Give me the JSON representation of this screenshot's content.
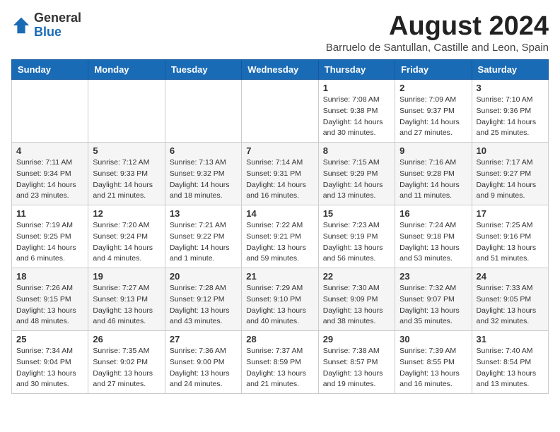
{
  "logo": {
    "general": "General",
    "blue": "Blue"
  },
  "title": "August 2024",
  "subtitle": "Barruelo de Santullan, Castille and Leon, Spain",
  "days_of_week": [
    "Sunday",
    "Monday",
    "Tuesday",
    "Wednesday",
    "Thursday",
    "Friday",
    "Saturday"
  ],
  "weeks": [
    [
      {
        "day": "",
        "info": ""
      },
      {
        "day": "",
        "info": ""
      },
      {
        "day": "",
        "info": ""
      },
      {
        "day": "",
        "info": ""
      },
      {
        "day": "1",
        "info": "Sunrise: 7:08 AM\nSunset: 9:38 PM\nDaylight: 14 hours\nand 30 minutes."
      },
      {
        "day": "2",
        "info": "Sunrise: 7:09 AM\nSunset: 9:37 PM\nDaylight: 14 hours\nand 27 minutes."
      },
      {
        "day": "3",
        "info": "Sunrise: 7:10 AM\nSunset: 9:36 PM\nDaylight: 14 hours\nand 25 minutes."
      }
    ],
    [
      {
        "day": "4",
        "info": "Sunrise: 7:11 AM\nSunset: 9:34 PM\nDaylight: 14 hours\nand 23 minutes."
      },
      {
        "day": "5",
        "info": "Sunrise: 7:12 AM\nSunset: 9:33 PM\nDaylight: 14 hours\nand 21 minutes."
      },
      {
        "day": "6",
        "info": "Sunrise: 7:13 AM\nSunset: 9:32 PM\nDaylight: 14 hours\nand 18 minutes."
      },
      {
        "day": "7",
        "info": "Sunrise: 7:14 AM\nSunset: 9:31 PM\nDaylight: 14 hours\nand 16 minutes."
      },
      {
        "day": "8",
        "info": "Sunrise: 7:15 AM\nSunset: 9:29 PM\nDaylight: 14 hours\nand 13 minutes."
      },
      {
        "day": "9",
        "info": "Sunrise: 7:16 AM\nSunset: 9:28 PM\nDaylight: 14 hours\nand 11 minutes."
      },
      {
        "day": "10",
        "info": "Sunrise: 7:17 AM\nSunset: 9:27 PM\nDaylight: 14 hours\nand 9 minutes."
      }
    ],
    [
      {
        "day": "11",
        "info": "Sunrise: 7:19 AM\nSunset: 9:25 PM\nDaylight: 14 hours\nand 6 minutes."
      },
      {
        "day": "12",
        "info": "Sunrise: 7:20 AM\nSunset: 9:24 PM\nDaylight: 14 hours\nand 4 minutes."
      },
      {
        "day": "13",
        "info": "Sunrise: 7:21 AM\nSunset: 9:22 PM\nDaylight: 14 hours\nand 1 minute."
      },
      {
        "day": "14",
        "info": "Sunrise: 7:22 AM\nSunset: 9:21 PM\nDaylight: 13 hours\nand 59 minutes."
      },
      {
        "day": "15",
        "info": "Sunrise: 7:23 AM\nSunset: 9:19 PM\nDaylight: 13 hours\nand 56 minutes."
      },
      {
        "day": "16",
        "info": "Sunrise: 7:24 AM\nSunset: 9:18 PM\nDaylight: 13 hours\nand 53 minutes."
      },
      {
        "day": "17",
        "info": "Sunrise: 7:25 AM\nSunset: 9:16 PM\nDaylight: 13 hours\nand 51 minutes."
      }
    ],
    [
      {
        "day": "18",
        "info": "Sunrise: 7:26 AM\nSunset: 9:15 PM\nDaylight: 13 hours\nand 48 minutes."
      },
      {
        "day": "19",
        "info": "Sunrise: 7:27 AM\nSunset: 9:13 PM\nDaylight: 13 hours\nand 46 minutes."
      },
      {
        "day": "20",
        "info": "Sunrise: 7:28 AM\nSunset: 9:12 PM\nDaylight: 13 hours\nand 43 minutes."
      },
      {
        "day": "21",
        "info": "Sunrise: 7:29 AM\nSunset: 9:10 PM\nDaylight: 13 hours\nand 40 minutes."
      },
      {
        "day": "22",
        "info": "Sunrise: 7:30 AM\nSunset: 9:09 PM\nDaylight: 13 hours\nand 38 minutes."
      },
      {
        "day": "23",
        "info": "Sunrise: 7:32 AM\nSunset: 9:07 PM\nDaylight: 13 hours\nand 35 minutes."
      },
      {
        "day": "24",
        "info": "Sunrise: 7:33 AM\nSunset: 9:05 PM\nDaylight: 13 hours\nand 32 minutes."
      }
    ],
    [
      {
        "day": "25",
        "info": "Sunrise: 7:34 AM\nSunset: 9:04 PM\nDaylight: 13 hours\nand 30 minutes."
      },
      {
        "day": "26",
        "info": "Sunrise: 7:35 AM\nSunset: 9:02 PM\nDaylight: 13 hours\nand 27 minutes."
      },
      {
        "day": "27",
        "info": "Sunrise: 7:36 AM\nSunset: 9:00 PM\nDaylight: 13 hours\nand 24 minutes."
      },
      {
        "day": "28",
        "info": "Sunrise: 7:37 AM\nSunset: 8:59 PM\nDaylight: 13 hours\nand 21 minutes."
      },
      {
        "day": "29",
        "info": "Sunrise: 7:38 AM\nSunset: 8:57 PM\nDaylight: 13 hours\nand 19 minutes."
      },
      {
        "day": "30",
        "info": "Sunrise: 7:39 AM\nSunset: 8:55 PM\nDaylight: 13 hours\nand 16 minutes."
      },
      {
        "day": "31",
        "info": "Sunrise: 7:40 AM\nSunset: 8:54 PM\nDaylight: 13 hours\nand 13 minutes."
      }
    ]
  ]
}
